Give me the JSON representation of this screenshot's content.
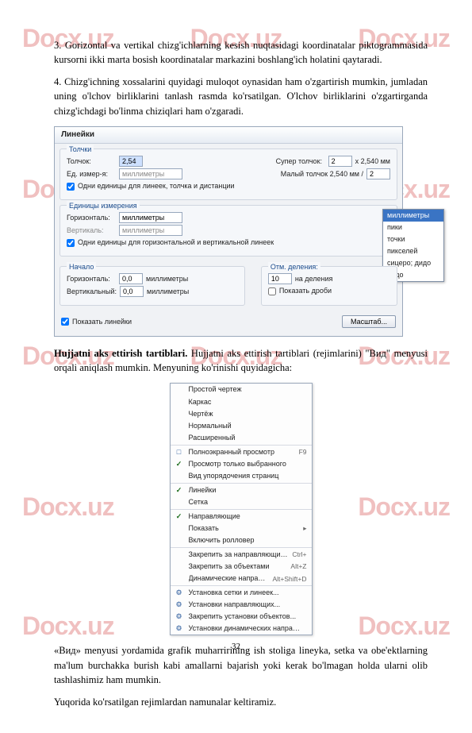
{
  "watermark": "Docx.uz",
  "para3": "3. Gorizontal va vertikal chizg'ichlarning kesish nuqtasidagi koordinatalar piktogrammasida kursorni ikki marta bosish koordinatalar markazini boshlang'ich holatini qaytaradi.",
  "para4": "4. Chizg'ichning xossalarini quyidagi muloqot oynasidan ham o'zgartirish mumkin, jumladan uning o'lchov birliklarini tanlash rasmda ko'rsatilgan. O'lchov birliklarini o'zgartirganda chizg'ichdagi bo'linma chiziqlari ham o'zgaradi.",
  "dialog1": {
    "title": "Линейки",
    "g1": {
      "title": "Толчки",
      "tolchok_lbl": "Толчок:",
      "tolchok_val": "2,54",
      "super_lbl": "Супер толчок:",
      "super_val": "2",
      "super_suffix": "x 2,540 мм",
      "ed_lbl": "Ед. измер-я:",
      "ed_val": "миллиметры",
      "maly_lbl": "Малый толчок 2,540 мм /",
      "maly_val": "2",
      "chk1": "Одни единицы для линеек, толчка и дистанции"
    },
    "g2": {
      "title": "Единицы измерения",
      "horiz_lbl": "Горизонталь:",
      "horiz_val": "миллиметры",
      "vert_lbl": "Вертикаль:",
      "vert_val": "миллиметры",
      "chk2": "Одни единицы для горизонтальной и вертикальной линеек",
      "dropdown": [
        "миллиметры",
        "пики",
        "точки",
        "пикселей",
        "сицеро; дидо",
        "дидо"
      ]
    },
    "g3": {
      "title": "Начало",
      "h_lbl": "Горизонталь:",
      "h_val": "0,0",
      "h_unit": "миллиметры",
      "v_lbl": "Вертикальный:",
      "v_val": "0,0",
      "v_unit": "миллиметры"
    },
    "g4": {
      "title": "Отм. деления:",
      "del_val": "10",
      "del_suffix": "на деления",
      "chk3": "Показать дроби"
    },
    "chk_show": "Показать линейки",
    "btn_scale": "Масштаб..."
  },
  "heading": {
    "bold": "Hujjatni aks ettirish tartiblari.",
    "rest": " Hujjatni aks ettirish tartiblari (rejimlarini) \"Вид\" menyusi orqali aniqlash mumkin. Menyuning ko'rinishi quyidagicha:"
  },
  "menu": {
    "items": [
      {
        "label": "Простой чертеж",
        "short": ""
      },
      {
        "label": "Каркас",
        "short": ""
      },
      {
        "label": "Чертёж",
        "short": ""
      },
      {
        "label": "Нормальный",
        "short": ""
      },
      {
        "label": "Расширенный",
        "short": ""
      },
      {
        "sep": true
      },
      {
        "icon": "□",
        "label": "Полноэкранный просмотр",
        "short": "F9"
      },
      {
        "icon": "✓",
        "chk": true,
        "label": "Просмотр только выбранного",
        "short": ""
      },
      {
        "label": "Вид упорядочения страниц",
        "short": ""
      },
      {
        "sep": true
      },
      {
        "icon": "✓",
        "chk": true,
        "label": "Линейки",
        "short": ""
      },
      {
        "label": "Сетка",
        "short": ""
      },
      {
        "sep": true
      },
      {
        "icon": "✓",
        "chk": true,
        "label": "Направляющие",
        "short": ""
      },
      {
        "label": "Показать",
        "short": "▸"
      },
      {
        "label": "Включить ролловер",
        "short": ""
      },
      {
        "sep": true
      },
      {
        "label": "Закрепить за направляющими",
        "short": "Ctrl+"
      },
      {
        "label": "Закрепить за объектами",
        "short": "Alt+Z"
      },
      {
        "label": "Динамические направляющие",
        "short": "Alt+Shift+D"
      },
      {
        "sep": true
      },
      {
        "icon": "⚙",
        "label": "Установка сетки и линеек...",
        "short": ""
      },
      {
        "icon": "⚙",
        "label": "Установки направляющих...",
        "short": ""
      },
      {
        "icon": "⚙",
        "label": "Закрепить установки объектов...",
        "short": ""
      },
      {
        "icon": "⚙",
        "label": "Установки динамических направляющих...",
        "short": ""
      }
    ]
  },
  "para_after1": "«Вид» menyusi yordamida grafik muharririning ish stoliga lineyka, setka va obe'ektlarning ma'lum burchakka burish kabi amallarni bajarish yoki kerak bo'lmagan holda ularni olib tashlashimiz ham mumkin.",
  "para_after2": "Yuqorida ko'rsatilgan rejimlardan namunalar keltiramiz.",
  "page_number": "32"
}
